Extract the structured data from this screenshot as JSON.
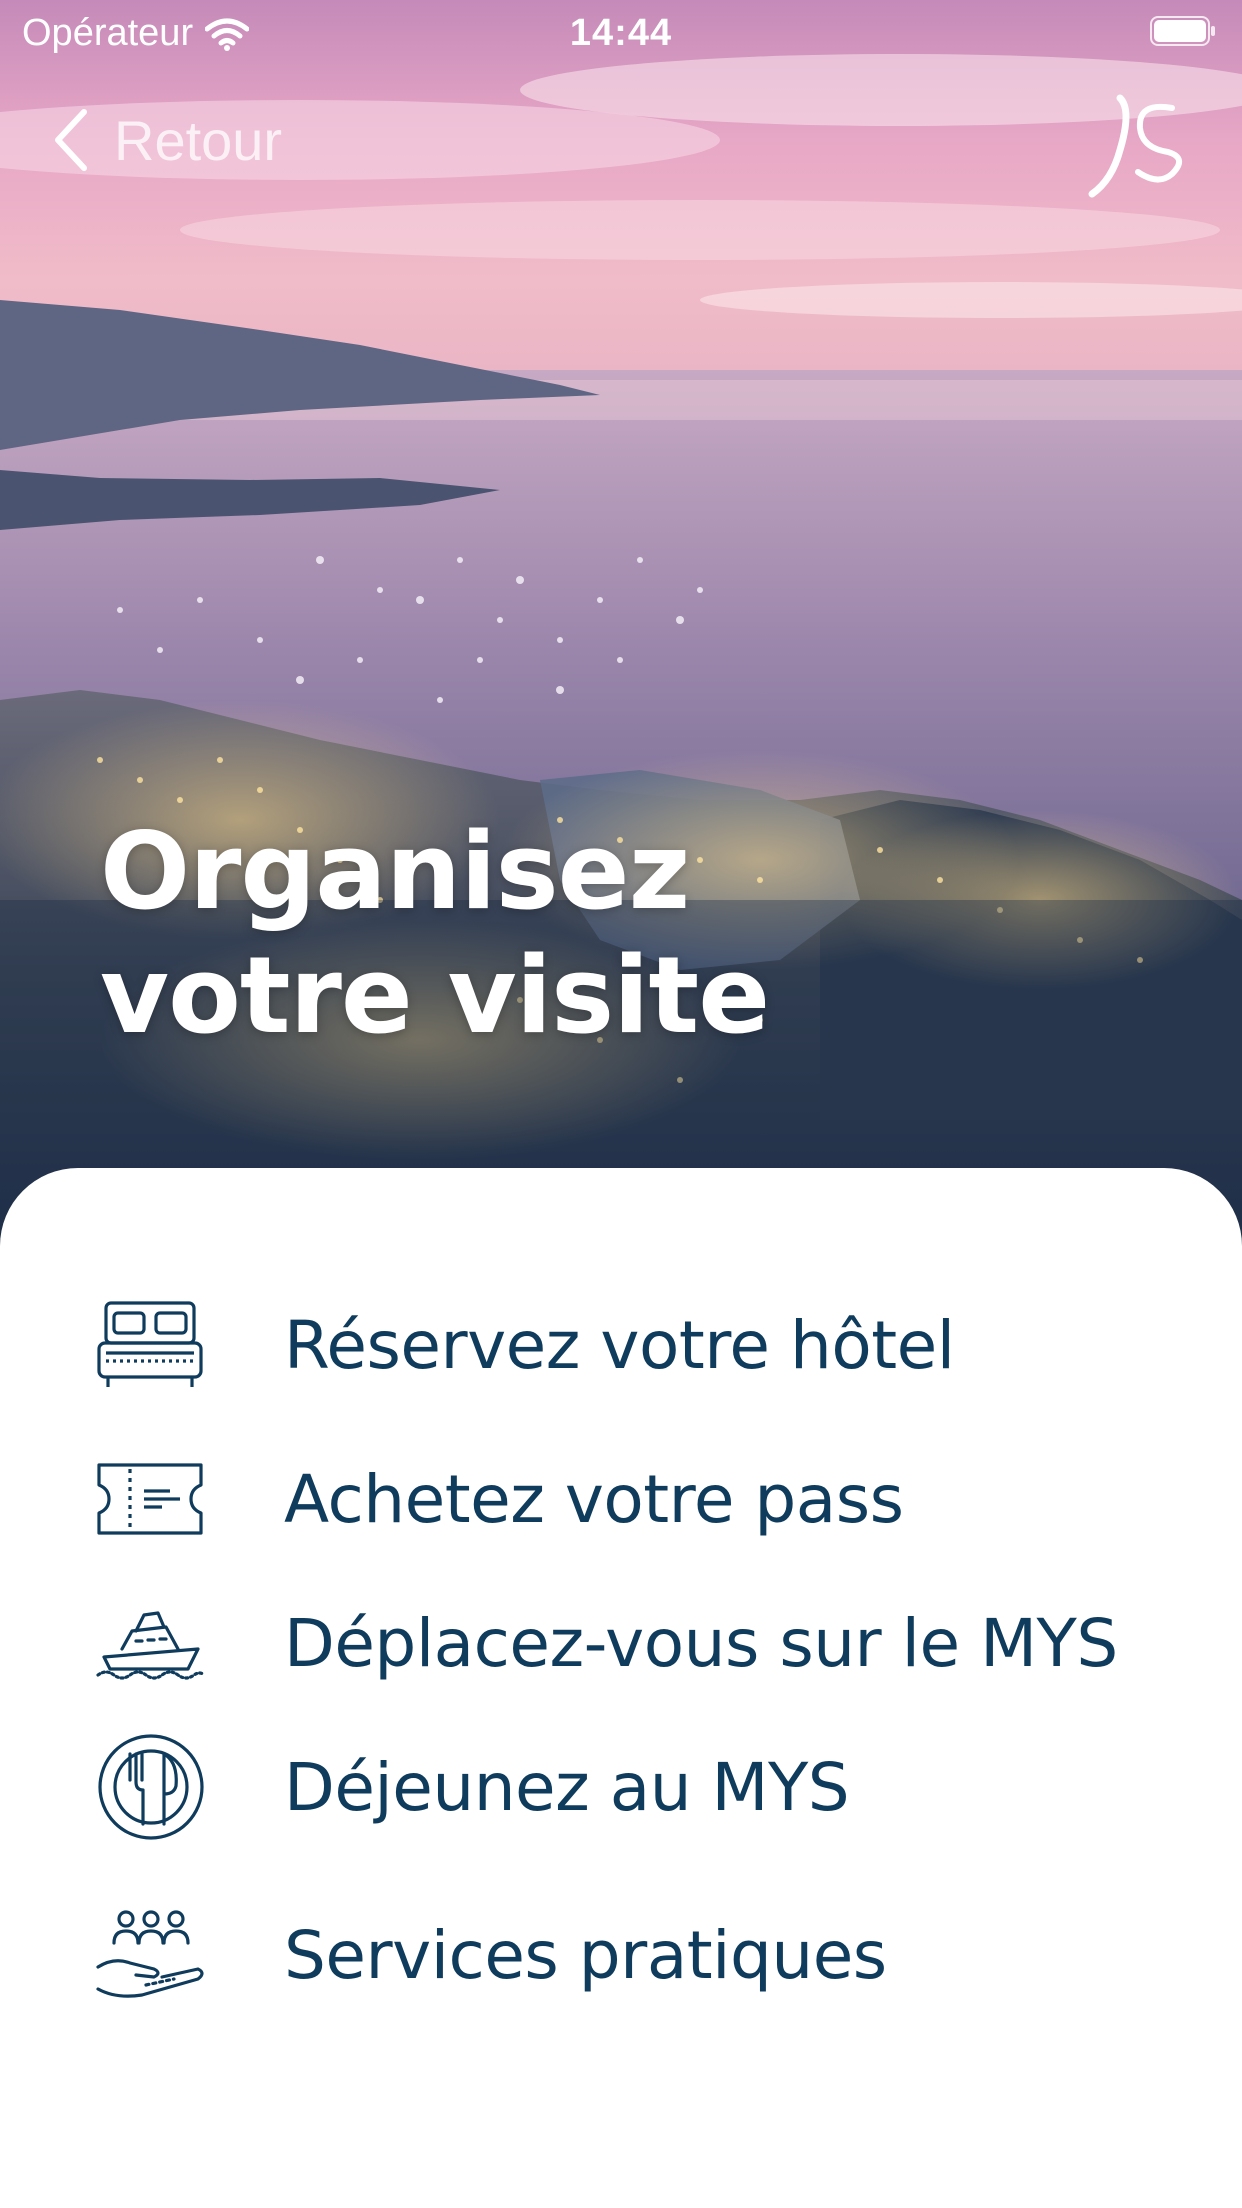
{
  "status_bar": {
    "carrier": "Opérateur",
    "time": "14:44",
    "icons": [
      "wifi-icon",
      "battery-icon"
    ]
  },
  "nav": {
    "back_label": "Retour",
    "logo_icon": "brand-logo-icon"
  },
  "hero": {
    "title_line1": "Organisez",
    "title_line2": "votre visite"
  },
  "menu": {
    "items": [
      {
        "label": "Réservez votre hôtel",
        "icon": "bed-icon"
      },
      {
        "label": "Achetez votre pass",
        "icon": "ticket-icon"
      },
      {
        "label": "Déplacez-vous sur le MYS",
        "icon": "boat-icon"
      },
      {
        "label": "Déjeunez au MYS",
        "icon": "dining-icon"
      },
      {
        "label": "Services pratiques",
        "icon": "services-hand-icon"
      }
    ]
  },
  "colors": {
    "text_primary": "#0f3b5c",
    "icon_color": "#0f3b5c",
    "sheet_background": "#ffffff",
    "sky_top": "#d98bb8",
    "sea": "#8e7ea3"
  }
}
